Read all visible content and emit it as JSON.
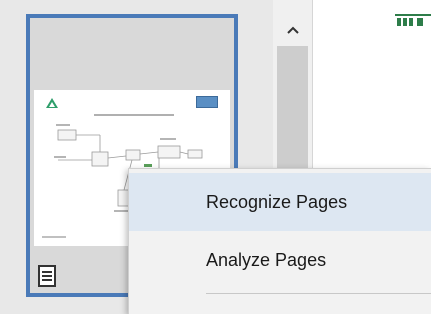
{
  "thumbnail_panel": {
    "page_icon": "page-icon"
  },
  "scrollbar": {
    "up_arrow": "chevron-up-icon"
  },
  "context_menu": {
    "items": [
      {
        "label": "Recognize Pages",
        "highlighted": true
      },
      {
        "label": "Analyze Pages",
        "highlighted": false
      }
    ]
  },
  "colors": {
    "selection_border": "#4a7ab8",
    "menu_hover": "#dde7f2",
    "menu_bg": "#f2f2f2"
  }
}
